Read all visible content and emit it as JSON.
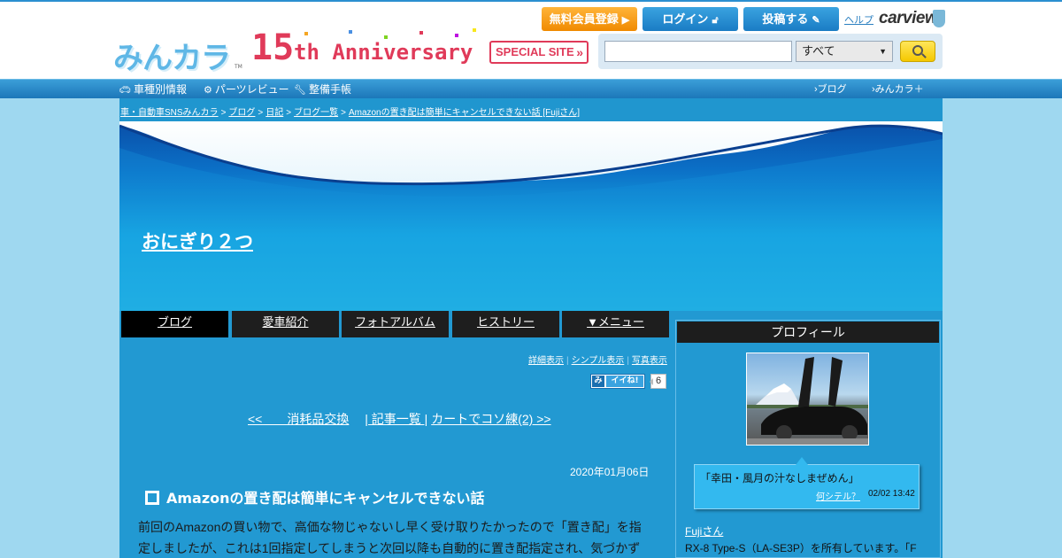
{
  "header": {
    "logo_text": "みんカラ",
    "logo_tm": "TM",
    "anniversary": {
      "number": "15",
      "word": "th Anniversary",
      "special_site": "SPECIAL SITE"
    },
    "buttons": {
      "register": "無料会員登録",
      "login": "ログイン",
      "post": "投稿する"
    },
    "help": "ヘルプ",
    "carview": "carview",
    "search": {
      "value": "",
      "category": "すべて"
    }
  },
  "nav": {
    "left": [
      "車種別情報",
      "パーツレビュー",
      "整備手帳"
    ],
    "right": [
      "ブログ",
      "みんカラ＋"
    ]
  },
  "breadcrumb": [
    "車・自動車SNSみんカラ",
    "ブログ",
    "日記",
    "ブログ一覧",
    "Amazonの置き配は簡単にキャンセルできない話 [Fujiさん]"
  ],
  "blog": {
    "title": "おにぎり２つ"
  },
  "tabs": [
    "ブログ",
    "愛車紹介",
    "フォトアルバム",
    "ヒストリー",
    "▼メニュー"
  ],
  "view_links": [
    "詳細表示",
    "シンプル表示",
    "写真表示"
  ],
  "iine": {
    "mi": "み",
    "label": "イイね!",
    "count": "6"
  },
  "pager": {
    "prev": "<<　　消耗品交換",
    "list": "| 記事一覧 |",
    "next": "カートでコソ練(2) >>"
  },
  "post": {
    "date": "2020年01月06日",
    "title": "Amazonの置き配は簡単にキャンセルできない話",
    "body_line1": "前回のAmazonの買い物で、高価な物じゃないし早く受け取りたかったので「置き配」を指",
    "body_line2": "定しましたが、これは1回指定してしまうと次回以降も自動的に置き配指定され、気づかず"
  },
  "profile": {
    "heading": "プロフィール",
    "quote": "「幸田・風月の汁なしまぜめん」",
    "what_link": "何シテル？",
    "time": "02/02 13:42",
    "name": "Fujiさん",
    "desc": "RX-8 Type-S（LA-SE3P）を所有しています。「F"
  },
  "colors": {
    "accent": "#2299d2",
    "nav": "#1c77b9",
    "register": "#f08a00",
    "anniv": "#e03a59"
  }
}
